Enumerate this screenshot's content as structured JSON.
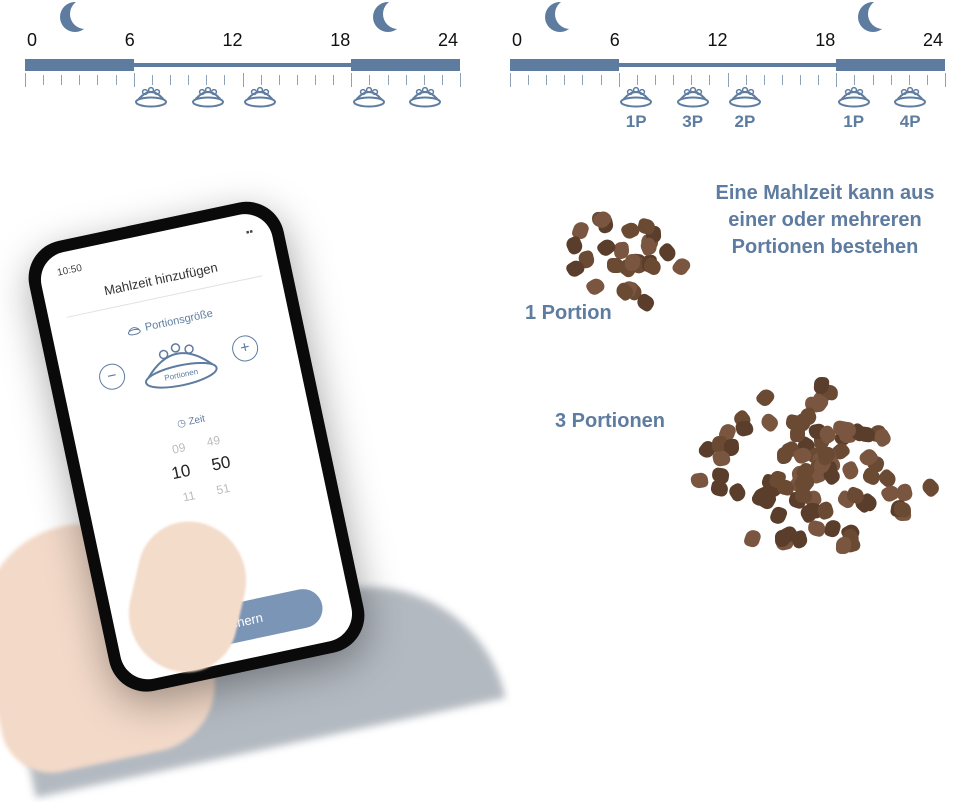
{
  "timeline": {
    "labels": [
      "0",
      "6",
      "12",
      "18",
      "24"
    ],
    "night_segments_pct": [
      [
        0,
        25
      ],
      [
        75,
        100
      ]
    ],
    "moon_positions_pct": [
      12.5,
      87
    ],
    "left_bowls_pct": [
      29,
      42,
      54,
      79,
      92
    ],
    "right_bowls": [
      {
        "pos": 29,
        "label": "1P"
      },
      {
        "pos": 42,
        "label": "3P"
      },
      {
        "pos": 54,
        "label": "2P"
      },
      {
        "pos": 79,
        "label": "1P"
      },
      {
        "pos": 92,
        "label": "4P"
      }
    ]
  },
  "phone": {
    "status_time": "10:50",
    "header": "Mahlzeit hinzufügen",
    "portion_label": "Portionsgröße",
    "bowl_caption": "Portionen",
    "time_label": "Zeit",
    "time_rows": [
      [
        "09",
        "49"
      ],
      [
        "10",
        "50"
      ],
      [
        "11",
        "51"
      ]
    ],
    "save": "Speichern"
  },
  "right": {
    "description": "Eine Mahlzeit kann aus einer oder mehreren Portionen bestehen",
    "label1": "1 Portion",
    "label2": "3 Portionen"
  }
}
